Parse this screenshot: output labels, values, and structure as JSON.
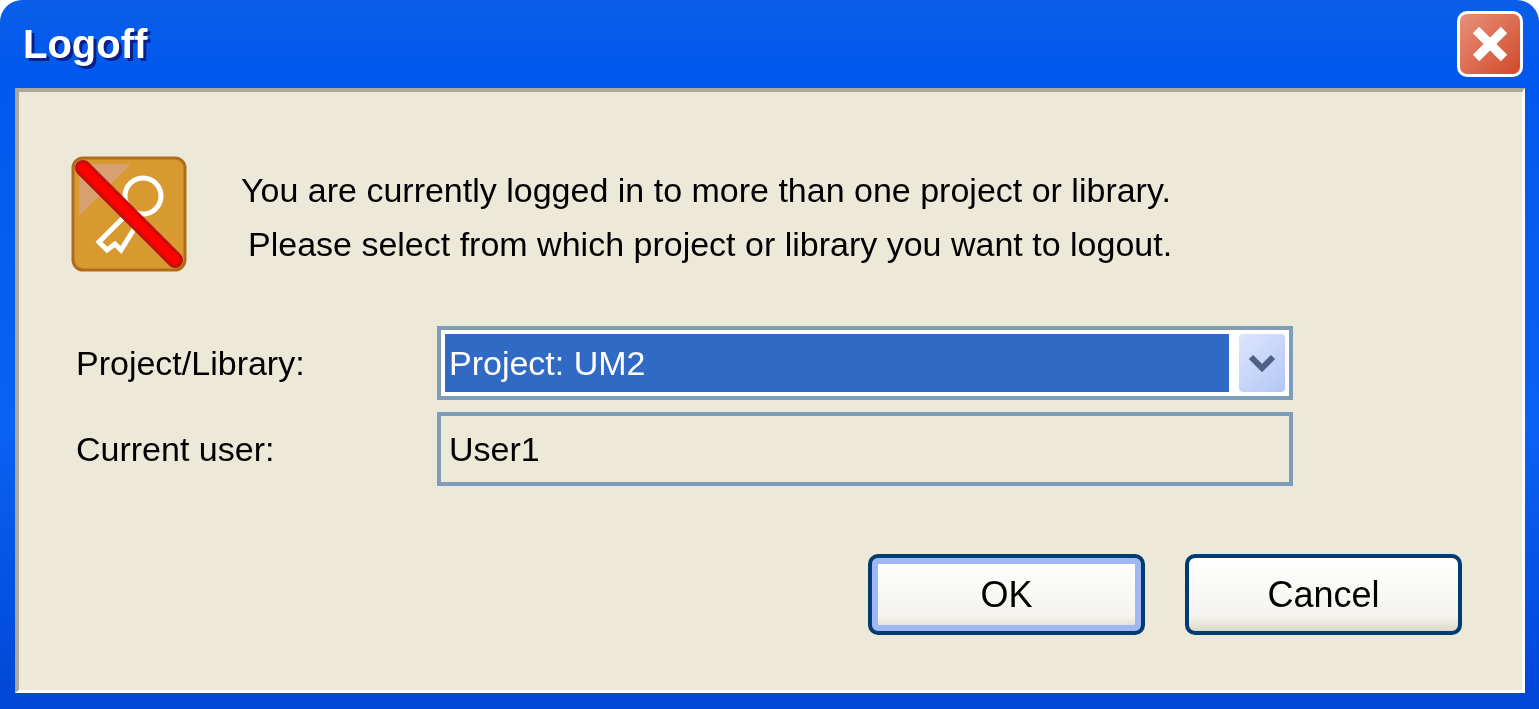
{
  "window": {
    "title": "Logoff"
  },
  "message": [
    "You are currently logged in to more than one project or library.",
    "Please select from which project or library you want to logout."
  ],
  "fields": [
    {
      "kind": "dropdown",
      "label": "Project/Library:",
      "value": "Project: UM2",
      "focused": true
    },
    {
      "kind": "readonly",
      "label": "Current user:",
      "value": "User1"
    }
  ],
  "buttons": [
    {
      "label": "OK",
      "default": true
    },
    {
      "label": "Cancel",
      "default": false
    }
  ]
}
